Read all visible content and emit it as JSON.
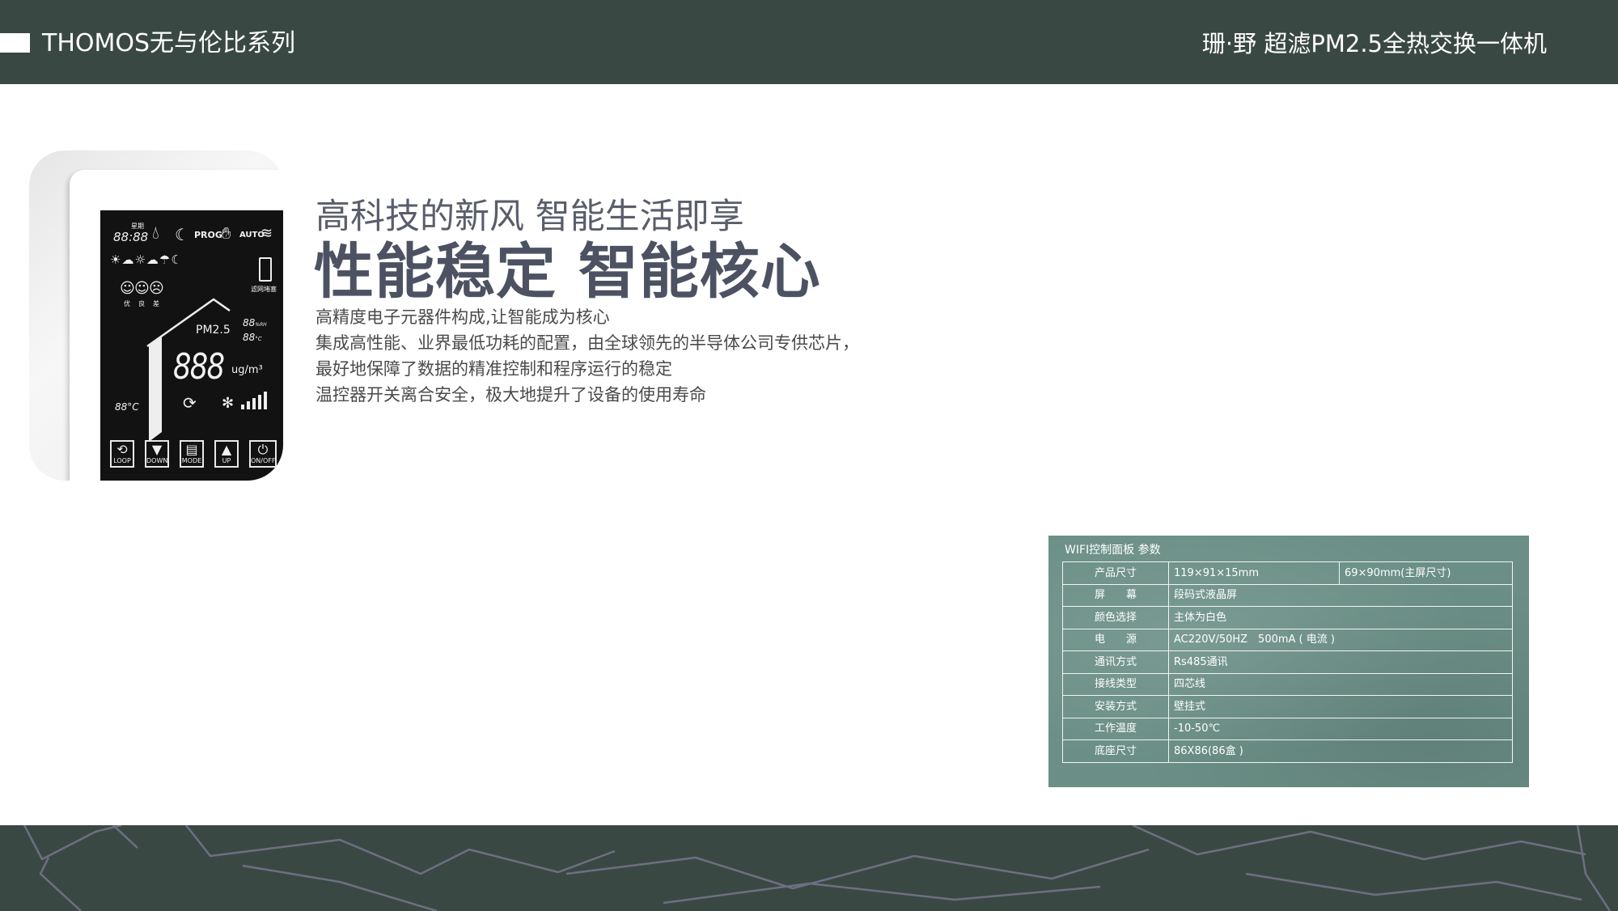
{
  "header": {
    "series": "THOMOS无与伦比系列",
    "product": "珊·野  超滤PM2.5全热交换一体机"
  },
  "device": {
    "time": "88:88",
    "weekday": "星期",
    "prog": "PROG",
    "auto": "AUTO",
    "filter_warn": "滤网堵塞",
    "air_quality": [
      "优",
      "良",
      "差"
    ],
    "pm_label": "PM2.5",
    "humidity": "88",
    "humidity_unit": "%RH",
    "temp_small": "88",
    "temp_unit": "°C",
    "main_value": "888",
    "main_unit": "ug/m³",
    "room_temp": "88°C",
    "buttons": [
      {
        "label": "LOOP",
        "icon": "loop-icon"
      },
      {
        "label": "DOWN",
        "icon": "down-arrow-icon"
      },
      {
        "label": "MODE",
        "icon": "mode-icon"
      },
      {
        "label": "UP",
        "icon": "up-arrow-icon"
      },
      {
        "label": "ON/OFF",
        "icon": "power-icon"
      }
    ]
  },
  "content": {
    "subtitle": "高科技的新风 智能生活即享",
    "title": "性能稳定 智能核心",
    "description": [
      "高精度电子元器件构成,让智能成为核心",
      "集成高性能、业界最低功耗的配置，由全球领先的半导体公司专供芯片，",
      "最好地保障了数据的精准控制和程序运行的稳定",
      "温控器开关离合安全，极大地提升了设备的使用寿命"
    ]
  },
  "specs": {
    "caption": "WIFI控制面板 参数",
    "rows": [
      {
        "key": "产品尺寸",
        "value": "119×91×15mm",
        "extra": "69×90mm(主屏尺寸)"
      },
      {
        "key": "屏　　幕",
        "value": "段码式液晶屏"
      },
      {
        "key": "颜色选择",
        "value": "主体为白色"
      },
      {
        "key": "电　　源",
        "value": "AC220V/50HZ　500mA ( 电流 )"
      },
      {
        "key": "通讯方式",
        "value": "Rs485通讯"
      },
      {
        "key": "接线类型",
        "value": "四芯线"
      },
      {
        "key": "安装方式",
        "value": "壁挂式"
      },
      {
        "key": "工作温度",
        "value": "-10-50℃"
      },
      {
        "key": "底座尺寸",
        "value": "86X86(86盒 )"
      }
    ]
  },
  "colors": {
    "header_bg": "#3a4843",
    "table_bg": "#6b8f86",
    "title_text": "#4d5262"
  }
}
